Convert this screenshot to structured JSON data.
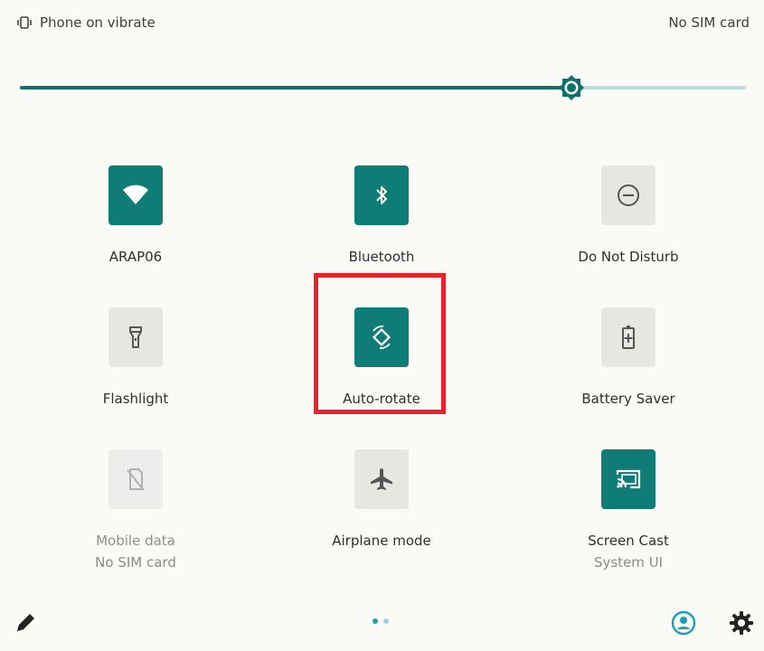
{
  "status_bar": {
    "ringer_text": "Phone on vibrate",
    "sim_text": "No SIM card",
    "ringer_icon": "vibrate-icon"
  },
  "brightness": {
    "level_fraction": 0.76,
    "fill_color": "#0f6f6d",
    "track_color": "#bcdcdc"
  },
  "tiles": [
    {
      "id": "wifi",
      "label": "ARAP06",
      "state": "on",
      "icon": "wifi-icon"
    },
    {
      "id": "bluetooth",
      "label": "Bluetooth",
      "state": "on",
      "icon": "bluetooth-icon"
    },
    {
      "id": "dnd",
      "label": "Do Not Disturb",
      "state": "off",
      "icon": "do-not-disturb-icon"
    },
    {
      "id": "flashlight",
      "label": "Flashlight",
      "state": "off",
      "icon": "flashlight-icon"
    },
    {
      "id": "autorotate",
      "label": "Auto-rotate",
      "state": "on",
      "icon": "auto-rotate-icon",
      "highlighted": true
    },
    {
      "id": "battery",
      "label": "Battery Saver",
      "state": "off",
      "icon": "battery-saver-icon"
    },
    {
      "id": "mobiledata",
      "label": "Mobile data",
      "sublabel": "No SIM card",
      "state": "disabled",
      "icon": "mobile-data-off-icon"
    },
    {
      "id": "airplane",
      "label": "Airplane mode",
      "state": "off",
      "icon": "airplane-icon"
    },
    {
      "id": "cast",
      "label": "Screen Cast",
      "sublabel": "System UI",
      "state": "on",
      "icon": "cast-icon"
    }
  ],
  "footer": {
    "edit_icon": "edit-pencil-icon",
    "user_icon": "user-account-icon",
    "settings_icon": "gear-icon",
    "page_count": 2,
    "current_page": 1
  },
  "colors": {
    "active_tile": "#0f7c76",
    "inactive_tile": "#e6e6e2",
    "highlight": "#e8232b",
    "accent": "#1a9fb4"
  }
}
